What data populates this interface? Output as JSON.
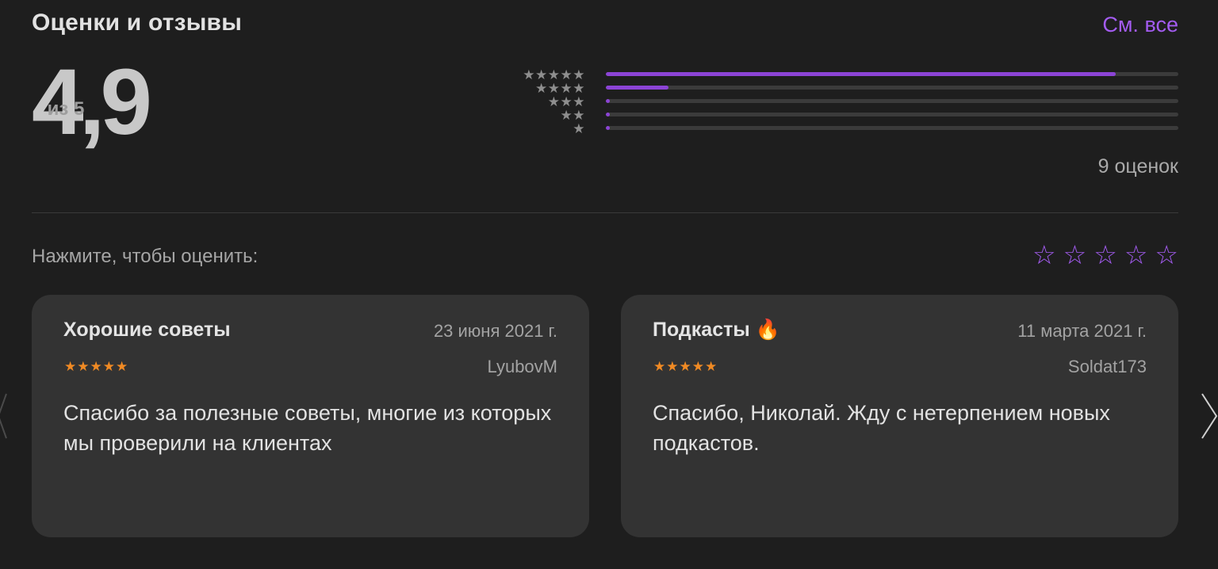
{
  "header": {
    "title": "Оценки и отзывы",
    "see_all": "См. все"
  },
  "rating": {
    "value": "4,9",
    "out_of": "из 5",
    "count_label": "9 оценок",
    "distribution": [
      {
        "stars": "★★★★★",
        "fraction": 0.89
      },
      {
        "stars": "★★★★",
        "fraction": 0.11
      },
      {
        "stars": "★★★",
        "fraction": 0.0
      },
      {
        "stars": "★★",
        "fraction": 0.0
      },
      {
        "stars": "★",
        "fraction": 0.0
      }
    ]
  },
  "rate_prompt": {
    "label": "Нажмите, чтобы оценить:",
    "stars": [
      "☆",
      "☆",
      "☆",
      "☆",
      "☆"
    ]
  },
  "reviews": [
    {
      "title": "Хорошие советы",
      "date": "23 июня 2021 г.",
      "stars": "★★★★★",
      "rating": 5,
      "author": "LyubovM",
      "text": "Спасибо за полезные советы, многие из которых мы проверили на клиентах"
    },
    {
      "title": "Подкасты 🔥",
      "date": "11 марта 2021 г.",
      "stars": "★★★★★",
      "rating": 5,
      "author": "Soldat173",
      "text": "Спасибо, Николай. Жду с нетерпением новых подкастов."
    }
  ],
  "colors": {
    "accent": "#a45cf2",
    "bar_fill": "#8c44d6",
    "review_star": "#f08a24",
    "background": "#1e1e1e",
    "card": "#333333"
  },
  "icons": {
    "nav_left": "chevron-left-icon",
    "nav_right": "chevron-right-icon"
  }
}
